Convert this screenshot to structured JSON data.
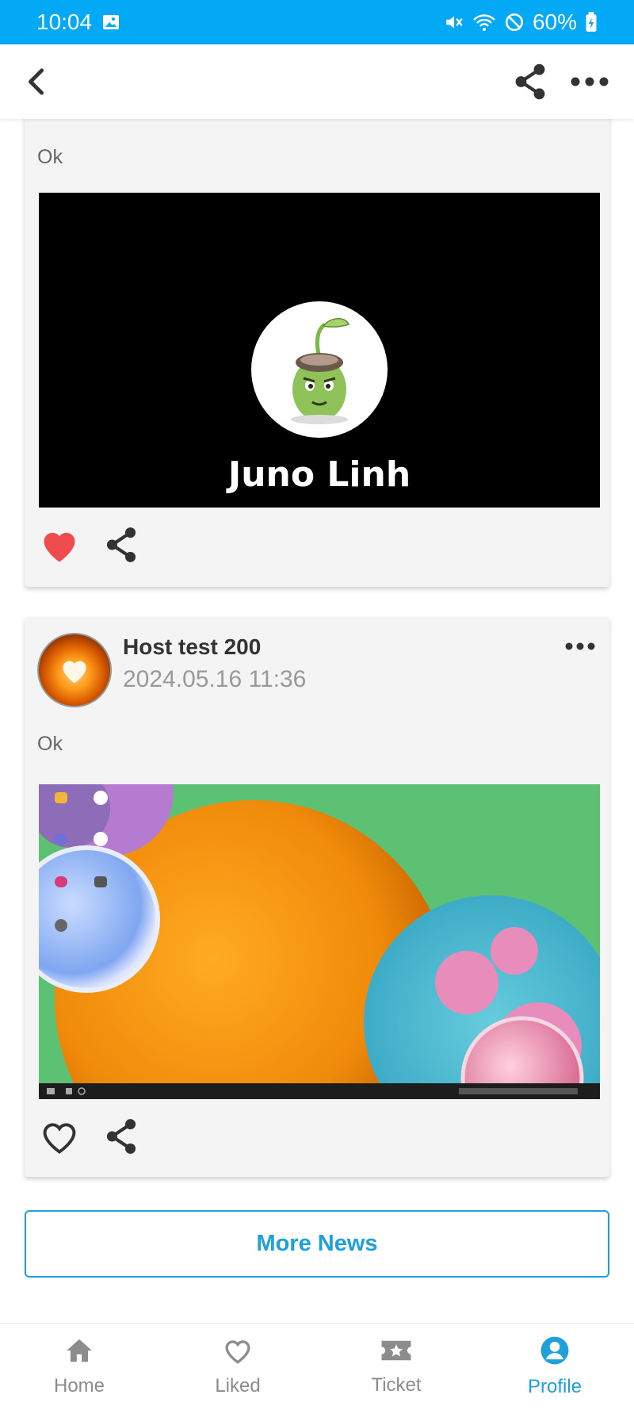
{
  "status_bar": {
    "time": "10:04",
    "battery": "60%",
    "background_color": "#03a9f4",
    "icons": [
      "gallery-icon",
      "mute-icon",
      "wifi-icon",
      "dnd-icon",
      "battery-icon"
    ]
  },
  "app_bar": {
    "icons": [
      "back-icon",
      "share-icon",
      "more-icon"
    ]
  },
  "posts": [
    {
      "text": "Ok",
      "video_caption": "Juno Linh",
      "liked": true
    },
    {
      "author": "Host test 200",
      "timestamp": "2024.05.16 11:36",
      "text": "Ok",
      "liked": false
    }
  ],
  "more_news_label": "More News",
  "accent_color": "#1da1d8",
  "like_color": "#ef4d4d",
  "bottom_nav": {
    "items": [
      {
        "label": "Home",
        "icon": "home-icon"
      },
      {
        "label": "Liked",
        "icon": "heart-icon"
      },
      {
        "label": "Ticket",
        "icon": "ticket-icon"
      },
      {
        "label": "Profile",
        "icon": "profile-icon"
      }
    ],
    "active": "Profile"
  }
}
